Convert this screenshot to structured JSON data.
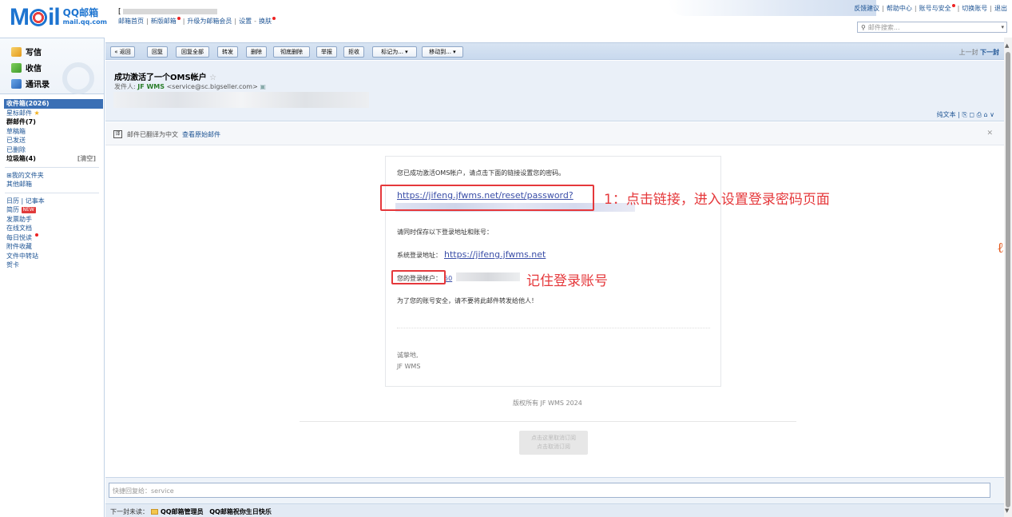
{
  "header": {
    "logo_text": "M",
    "logo_text_end": "il",
    "brand_cn": "QQ邮箱",
    "brand_url": "mail.qq.com",
    "user_initial": "[",
    "top_links": [
      "邮箱首页",
      "新版邮箱",
      "升级为邮箱会员",
      "设置",
      "换肤"
    ],
    "right_links": [
      "反馈建议",
      "帮助中心",
      "账号与安全",
      "切换账号",
      "退出"
    ],
    "search_placeholder": "邮件搜索..."
  },
  "sidebar": {
    "actions": [
      "写信",
      "收信",
      "通讯录"
    ],
    "inbox": "收件箱(2026)",
    "starred": "星标邮件",
    "group": "群邮件(7)",
    "drafts": "草稿箱",
    "sent": "已发送",
    "deleted": "已删除",
    "spam": "垃圾箱(4)",
    "spam_clear": "[清空]",
    "my_folders": "⊞我的文件夹",
    "other": "其他邮箱",
    "calendar": "日历",
    "notes": "记事本",
    "resume": "简历",
    "new_badge": "NEW",
    "invoice": "发票助手",
    "docs": "在线文档",
    "daily": "每日悦读",
    "attach": "附件收藏",
    "transfer": "文件中转站",
    "cards": "贺卡"
  },
  "toolbar": {
    "buttons": [
      "« 返回",
      "回复",
      "回复全部",
      "转发",
      "删除",
      "彻底删除",
      "举报",
      "拒收",
      "标记为... ▾",
      "移动到... ▾"
    ],
    "prev": "上一封",
    "next": "下一封"
  },
  "mail": {
    "subject": "成功激活了一个OMS帐户",
    "sender_label": "发件人:",
    "sender_name": "JF WMS",
    "sender_addr": "<service@sc.bigseller.com>",
    "plain_text": "纯文本 | ⎘ ◻ ⎙ ⌂ ∨",
    "translate_text": "邮件已翻译为中文",
    "translate_link": "查看原始邮件"
  },
  "body": {
    "intro": "您已成功激活OMS帐户，请点击下面的链接设置您的密码。",
    "reset_link": "https://jifeng.jfwms.net/reset/password?",
    "save_note": "请同时保存以下登录地址和账号：",
    "site_label": "系统登录地址：",
    "site_link": "https://jifeng.jfwms.net",
    "account_label": "您的登录帐户：",
    "account_value": "50",
    "warning": "为了您的账号安全，请不要将此邮件转发给他人！",
    "regards": "诚挚地,",
    "signature": "JF WMS",
    "copyright": "版权所有 JF WMS 2024",
    "unsub_line1": "点击这里取消订阅",
    "unsub_line2": "点击取消订阅"
  },
  "annotations": {
    "step1": "1：点击链接，进入设置登录密码页面",
    "step2": "记住登录账号"
  },
  "footer": {
    "quick_reply": "快捷回复给：service",
    "next_unread": "下一封未读：",
    "next_sender": "QQ邮箱管理员",
    "next_subject": "QQ邮箱祝你生日快乐"
  },
  "colors": {
    "accent": "#1d74d0",
    "link": "#3b4fa8",
    "annotation": "#e5383b",
    "selected_folder": "#3a6fb5"
  }
}
